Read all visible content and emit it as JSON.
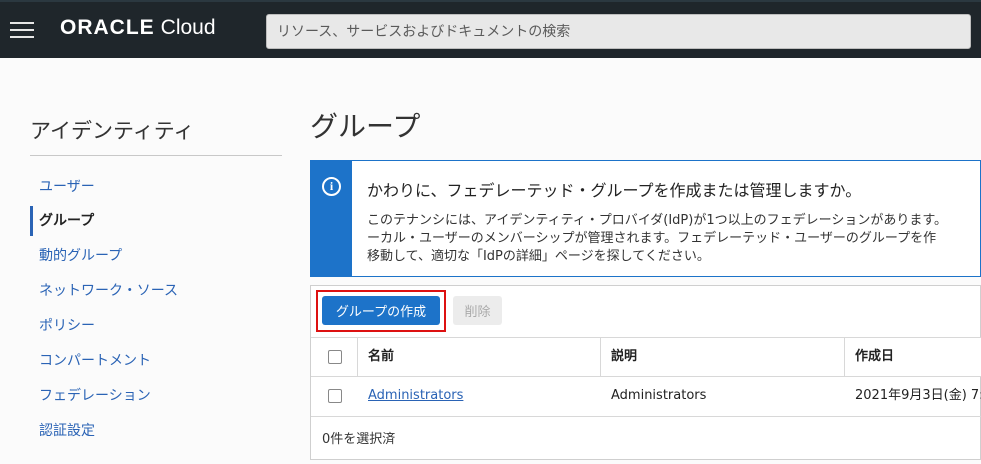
{
  "header": {
    "brand_oracle": "ORACLE",
    "brand_cloud": "Cloud",
    "search_placeholder": "リソース、サービスおよびドキュメントの検索"
  },
  "sidebar": {
    "title": "アイデンティティ",
    "items": [
      {
        "label": "ユーザー"
      },
      {
        "label": "グループ"
      },
      {
        "label": "動的グループ"
      },
      {
        "label": "ネットワーク・ソース"
      },
      {
        "label": "ポリシー"
      },
      {
        "label": "コンパートメント"
      },
      {
        "label": "フェデレーション"
      },
      {
        "label": "認証設定"
      }
    ],
    "active_index": 1
  },
  "main": {
    "title": "グループ",
    "info": {
      "icon": "info-icon",
      "title": "かわりに、フェデレーテッド・グループを作成または管理しますか。",
      "lines": [
        "このテナンシには、アイデンティティ・プロバイダ(IdP)が1つ以上のフェデレーションがあります。",
        "ーカル・ユーザーのメンバーシップが管理されます。フェデレーテッド・ユーザーのグループを作",
        "移動して、適切な「IdPの詳細」ページを探してください。"
      ]
    },
    "actions": {
      "create_label": "グループの作成",
      "delete_label": "削除"
    },
    "table": {
      "columns": [
        "名前",
        "説明",
        "作成日"
      ],
      "rows": [
        {
          "name": "Administrators",
          "description": "Administrators",
          "created": "2021年9月3日(金) 7:"
        }
      ],
      "selection_text": "0件を選択済"
    }
  },
  "colors": {
    "accent": "#1d73c9",
    "topbar": "#1f262b",
    "highlight": "#dd1111"
  }
}
